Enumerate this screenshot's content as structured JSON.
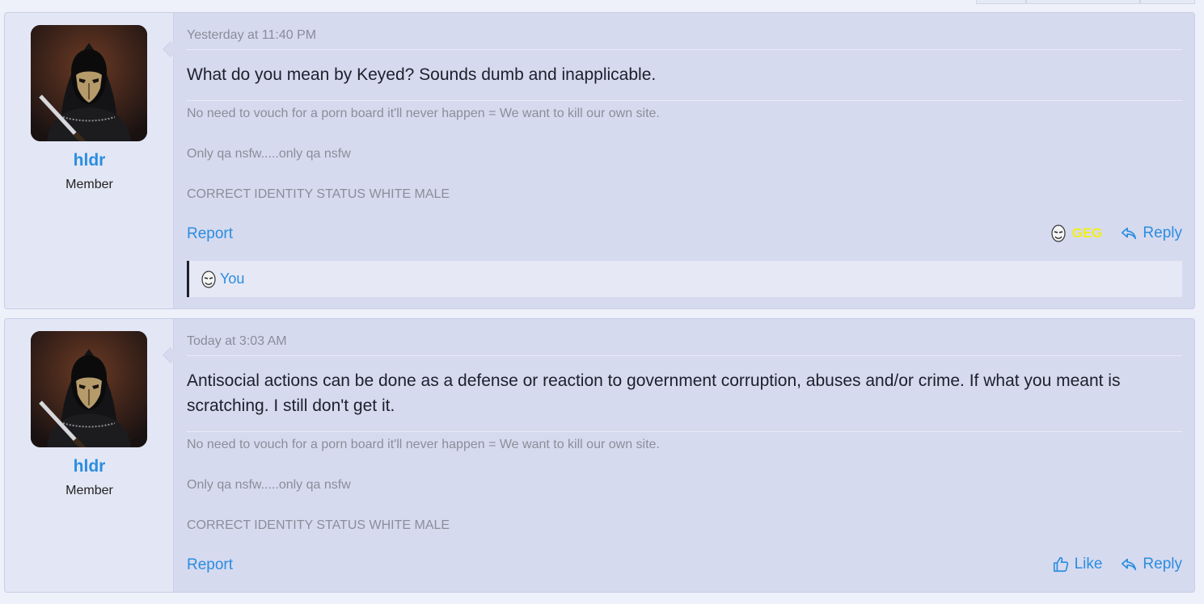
{
  "posts": [
    {
      "username": "hldr",
      "user_title": "Member",
      "date": "Yesterday at 11:40 PM",
      "message": "What do you mean by Keyed? Sounds dumb and inapplicable.",
      "signature": [
        "No need to vouch for a porn board it'll never happen = We want to kill our own site.",
        "Only qa nsfw.....only qa nsfw",
        "CORRECT IDENTITY STATUS WHITE MALE"
      ],
      "report_label": "Report",
      "reaction_label": "GEG",
      "reply_label": "Reply",
      "reacted_by": "You"
    },
    {
      "username": "hldr",
      "user_title": "Member",
      "date": "Today at 3:03 AM",
      "message": "Antisocial actions can be done as a defense or reaction to government corruption, abuses and/or crime. If what you meant is scratching. I still don't get it.",
      "signature": [
        "No need to vouch for a porn board it'll never happen = We want to kill our own site.",
        "Only qa nsfw.....only qa nsfw",
        "CORRECT IDENTITY STATUS WHITE MALE"
      ],
      "report_label": "Report",
      "like_label": "Like",
      "reply_label": "Reply"
    }
  ],
  "colors": {
    "accent": "#2a8de0",
    "post_bg": "#d6daef",
    "user_col_bg": "#e3e6f4",
    "muted_text": "#8b8d98",
    "reaction_geg": "#f2ee1a"
  },
  "icons": {
    "reply": "reply-arrow-icon",
    "like": "thumbs-up-icon",
    "reaction": "masked-face-reaction-icon"
  }
}
